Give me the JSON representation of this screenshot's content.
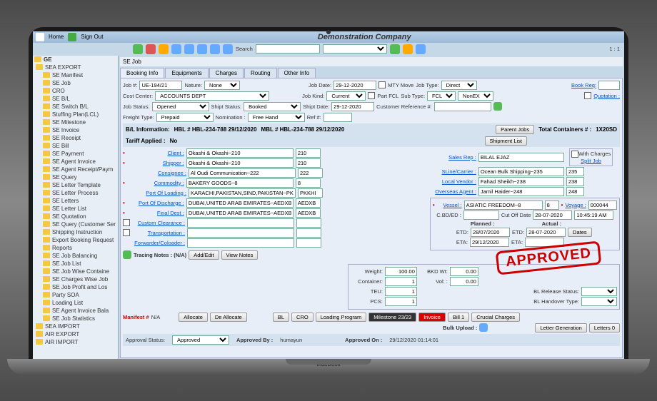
{
  "header": {
    "home": "Home",
    "sign_out": "Sign Out",
    "company": "Demonstration Company"
  },
  "toolbar": {
    "search_label": "Search",
    "page_indicator": "1 : 1"
  },
  "sidebar": {
    "root": "GE",
    "sections": [
      {
        "label": "SEA EXPORT",
        "open": true,
        "children": [
          "SE Manifest",
          "SE Job",
          "CRO",
          "SE B/L",
          "SE Switch B/L",
          "Stuffing Plan(LCL)",
          "SE Milestone",
          "SE Invoice",
          "SE Receipt",
          "SE Bill",
          "SE Payment",
          "SE Agent Invoice",
          "SE Agent Receipt/Paym",
          "SE Query",
          "SE Letter Template",
          "SE Letter Process",
          "SE Letters",
          "SE Letter List",
          "SE Quotation",
          "SE Query (Customer Ser",
          "Shipping Instruction",
          "Export Booking Request",
          {
            "label": "Reports",
            "children": [
              "SE Job Balancing",
              "SE Job List",
              "SE Job Wise Containe",
              "SE Charges Wise Job",
              "SE Job Profit and Los",
              "Party SOA",
              "Loading List",
              "SE Agent Invoice Bala",
              "SE Job Statistics"
            ]
          }
        ]
      },
      {
        "label": "SEA IMPORT"
      },
      {
        "label": "AIR EXPORT"
      },
      {
        "label": "AIR IMPORT"
      }
    ]
  },
  "window": {
    "title": "SE Job"
  },
  "tabs": [
    "Booking Info",
    "Equipments",
    "Charges",
    "Routing",
    "Other Info"
  ],
  "form": {
    "job_no_lbl": "Job #:",
    "job_no": "UE-194/21",
    "nature_lbl": "Nature:",
    "nature": "None",
    "job_date_lbl": "Job Date:",
    "job_date": "29-12-2020",
    "mty_move": "MTY Move",
    "job_type_lbl": "Job Type:",
    "job_type": "Direct",
    "book_rec": "Book Req:",
    "cost_center_lbl": "Cost Center:",
    "cost_center": "ACCOUNTS DEPT",
    "job_kind_lbl": "Job Kind:",
    "job_kind": "Current",
    "part_fcl": "Part FCL",
    "sub_type_lbl": "Sub Type:",
    "sub_type": "FCL",
    "sub_type2": "NonEX",
    "quotation": "Quotation :",
    "job_status_lbl": "Job Status:",
    "job_status": "Opened",
    "ship_status_lbl": "Shipt Status:",
    "ship_status": "Booked",
    "ship_date_lbl": "Shipt Date:",
    "ship_date": "29-12-2020",
    "cust_ref_lbl": "Customer Reference #:",
    "cust_ref": "",
    "freight_type_lbl": "Freight Type:",
    "freight_type": "Prepaid",
    "nomination_lbl": "Nomination :",
    "nomination": "Free Hand",
    "ref_lbl": "Ref #:"
  },
  "info": {
    "bl": "B/L Information:",
    "hbl": "HBL # HBL-234-788  29/12/2020",
    "mbl": "MBL # HBL-234-788  29/12/2020",
    "parent_jobs": "Parent Jobs",
    "total_containers_lbl": "Total Containers # :",
    "total_containers": "1X20SD",
    "tariff": "Tariff Applied :",
    "tariff_val": "No",
    "shipment_list": "Shipment List"
  },
  "parties": {
    "client_lbl": "Client :",
    "client": "Okashi & Okashi~210",
    "client_code": "210",
    "shipper_lbl": "Shipper :",
    "shipper": "Okashi & Okashi~210",
    "shipper_code": "210",
    "consignee_lbl": "Consignee :",
    "consignee": "Al Oudi Communication~222",
    "consignee_code": "222",
    "commodity_lbl": "Commodity :",
    "commodity": "BAKERY GOODS~8",
    "commodity_code": "8",
    "pol_lbl": "Port Of Loading :",
    "pol": "KARACHI,PAKISTAN,SIND,PAKISTAN~PKKHI",
    "pol_code": "PKKHI",
    "pod_lbl": "Port Of Discharge :",
    "pod": "DUBAI,UNITED ARAB EMIRATES~AEDXB",
    "pod_code": "AEDXB",
    "final_lbl": "Final Dest :",
    "final": "DUBAI,UNITED ARAB EMIRATES~AEDXB",
    "final_code": "AEDXB",
    "custom_lbl": "Custom Clearance :",
    "trans_lbl": "Transportation :",
    "forwarder_lbl": "Forwarder/Coloader :"
  },
  "right_parties": {
    "sales_lbl": "Sales Rep :",
    "sales": "BILAL EJAZ",
    "sline_lbl": "SLine/Carrier :",
    "sline": "Ocean Bulk Shipping~235",
    "sline_code": "235",
    "vendor_lbl": "Local Vendor :",
    "vendor": "Fahad Sheikh~238",
    "vendor_code": "238",
    "agent_lbl": "Overseas Agent :",
    "agent": "Jamil Haider~248",
    "agent_code": "248",
    "with_charges": "With Charges",
    "split_job": "Split Job"
  },
  "vessel": {
    "vessel_lbl": "Vessel :",
    "vessel": "ASIATIC FREEDOM~8",
    "vessel_code": "8",
    "voyage_lbl": "Voyage :",
    "voyage": "000044",
    "cbd_lbl": "C.BD/ED :",
    "cutoff_lbl": "Cut Off Date",
    "cutoff": "28-07-2020",
    "cutoff_time": "10:45:19 AM",
    "planned": "Planned :",
    "actual": "Actual :",
    "etd_lbl": "ETD:",
    "etd_p": "28/07/2020",
    "etd_a": "28-07-2020",
    "eta_lbl": "ETA:",
    "eta_p": "29/12/2020",
    "dates_btn": "Dates"
  },
  "tracing": {
    "label": "Tracing Notes : (N/A)",
    "add": "Add/Edit",
    "view": "View Notes"
  },
  "weight": {
    "weight_lbl": "Weight:",
    "weight": "100.00",
    "bkd_lbl": "BKD Wt:",
    "bkd": "0.00",
    "container_lbl": "Container:",
    "container": "1",
    "vol_lbl": "Vol: :",
    "vol": "0.00",
    "teu_lbl": "TEU:",
    "teu": "1",
    "pcs_lbl": "PCS:",
    "pcs": "1",
    "bl_status_lbl": "BL Release Status:",
    "bl_handover_lbl": "BL Handover Type:"
  },
  "manifest": {
    "label": "Manifest #",
    "val": "N/A",
    "allocate": "Allocate",
    "dealloc": "De Allocate"
  },
  "buttons": {
    "bl": "BL",
    "cro": "CRO",
    "loading": "Loading Program",
    "milestone": "Milestone 23/23",
    "invoice": "Invoice",
    "bill": "Bill 1",
    "crucial": "Crucial Charges",
    "bulk": "Bulk Upload :",
    "letter_gen": "Letter Generation",
    "letters": "Letters 0"
  },
  "stamp": "APPROVED",
  "footer": {
    "status_lbl": "Approval Status:",
    "status": "Approved",
    "by_lbl": "Approved By :",
    "by": "humayun",
    "on_lbl": "Approved On :",
    "on": "29/12/2020 01:14:01"
  },
  "macbook": "MacBook"
}
